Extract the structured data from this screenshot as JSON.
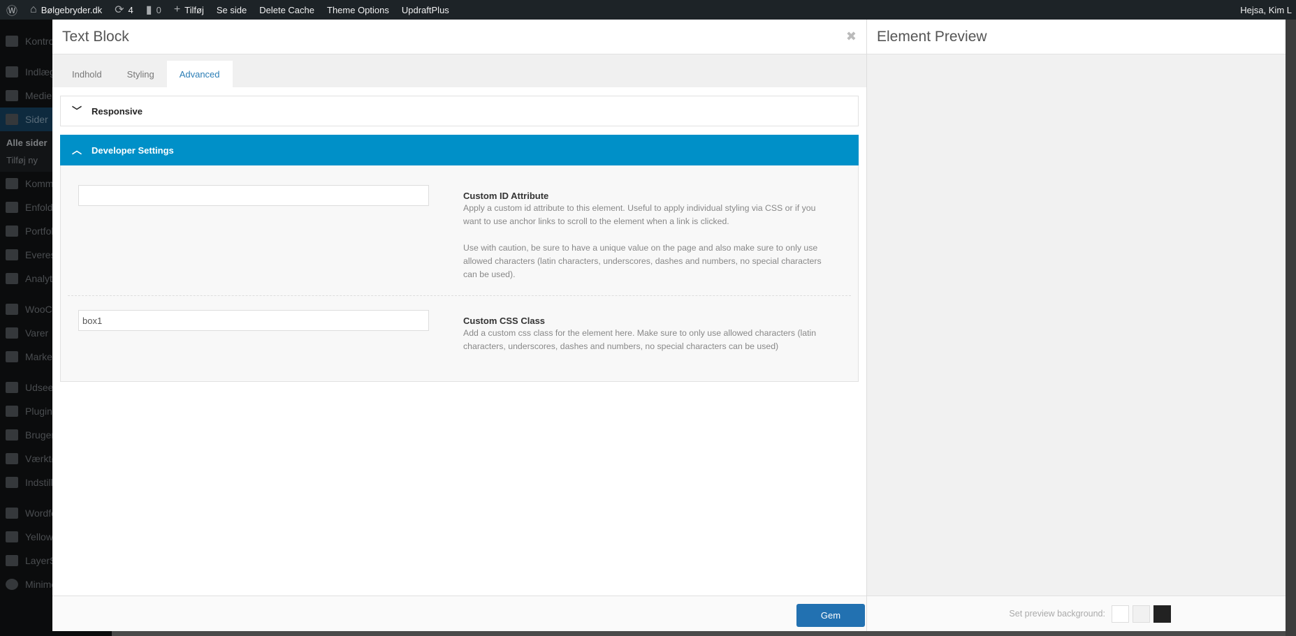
{
  "adminbar": {
    "site": "Bølgebryder.dk",
    "updates": "4",
    "comments": "0",
    "new": "Tilføj",
    "view": "Se side",
    "cache": "Delete Cache",
    "theme": "Theme Options",
    "updraft": "UpdraftPlus",
    "greeting": "Hejsa, Kim L"
  },
  "sidebar": {
    "items": [
      "Kontro",
      "Indlæg",
      "Medier",
      "Sider",
      "Komm",
      "Enfold",
      "Portfol",
      "Everest",
      "Analyti",
      "WooCo",
      "Varer",
      "Market",
      "Udseen",
      "Plugins",
      "Bruger",
      "Værktø",
      "Indstill",
      "Wordfe",
      "Yellow",
      "LayerS",
      "Minime"
    ],
    "sub": [
      "Alle sider",
      "Tilføj ny"
    ]
  },
  "modal": {
    "title": "Text Block",
    "tabs": [
      "Indhold",
      "Styling",
      "Advanced"
    ],
    "active_tab": "Advanced",
    "responsive": "Responsive",
    "developer": "Developer Settings",
    "id_field": {
      "value": "",
      "label": "Custom ID Attribute",
      "desc1": "Apply a custom id attribute to this element. Useful to apply individual styling via CSS or if you want to use anchor links to scroll to the element when a link is clicked.",
      "desc2": "Use with caution, be sure to have a unique value on the page and also make sure to only use allowed characters (latin characters, underscores, dashes and numbers, no special characters can be used)."
    },
    "css_field": {
      "value": "box1",
      "label": "Custom CSS Class",
      "desc": "Add a custom css class for the element here. Make sure to only use allowed characters (latin characters, underscores, dashes and numbers, no special characters can be used)"
    },
    "save": "Gem"
  },
  "preview": {
    "title": "Element Preview",
    "bg_label": "Set preview background:",
    "swatches": [
      "#ffffff",
      "#f1f1f1",
      "#222222"
    ]
  },
  "colors": {
    "accent": "#0090c8",
    "button": "#2271b1"
  }
}
